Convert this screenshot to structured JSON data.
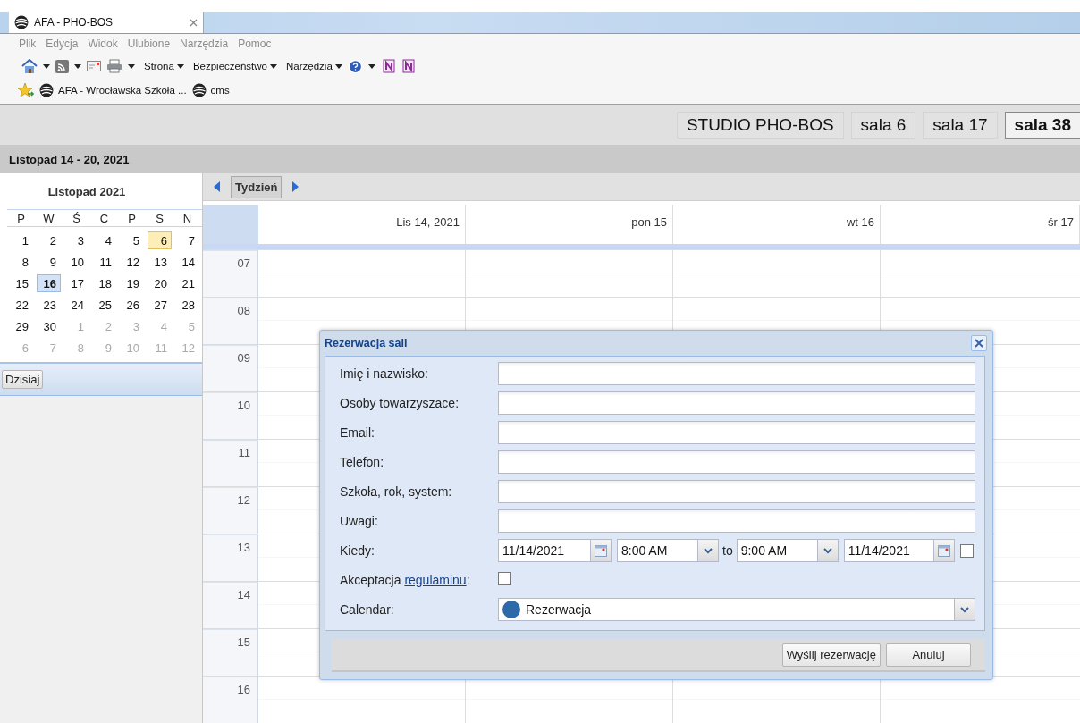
{
  "browser": {
    "tab_title": "AFA - PHO-BOS",
    "menu": [
      "Plik",
      "Edycja",
      "Widok",
      "Ulubione",
      "Narzędzia",
      "Pomoc"
    ],
    "toolbar_menus": [
      "Strona",
      "Bezpieczeństwo",
      "Narzędzia"
    ],
    "favorites": [
      "AFA - Wrocławska Szkoła ...",
      "cms"
    ]
  },
  "rooms": [
    {
      "label": "STUDIO PHO-BOS",
      "selected": false
    },
    {
      "label": "sala 6",
      "selected": false
    },
    {
      "label": "sala 17",
      "selected": false
    },
    {
      "label": "sala 38",
      "selected": true
    }
  ],
  "week_title": "Listopad 14 - 20, 2021",
  "mini_calendar": {
    "title": "Listopad 2021",
    "weekdays": [
      "P",
      "W",
      "Ś",
      "C",
      "P",
      "S",
      "N"
    ],
    "today_button": "Dzisiaj",
    "days": [
      {
        "label": "1",
        "other_month": false,
        "selected": false,
        "today": false
      },
      {
        "label": "2",
        "other_month": false,
        "selected": false,
        "today": false
      },
      {
        "label": "3",
        "other_month": false,
        "selected": false,
        "today": false
      },
      {
        "label": "4",
        "other_month": false,
        "selected": false,
        "today": false
      },
      {
        "label": "5",
        "other_month": false,
        "selected": false,
        "today": false
      },
      {
        "label": "6",
        "other_month": false,
        "selected": false,
        "today": true
      },
      {
        "label": "7",
        "other_month": false,
        "selected": false,
        "today": false
      },
      {
        "label": "8",
        "other_month": false,
        "selected": false,
        "today": false
      },
      {
        "label": "9",
        "other_month": false,
        "selected": false,
        "today": false
      },
      {
        "label": "10",
        "other_month": false,
        "selected": false,
        "today": false
      },
      {
        "label": "11",
        "other_month": false,
        "selected": false,
        "today": false
      },
      {
        "label": "12",
        "other_month": false,
        "selected": false,
        "today": false
      },
      {
        "label": "13",
        "other_month": false,
        "selected": false,
        "today": false
      },
      {
        "label": "14",
        "other_month": false,
        "selected": false,
        "today": false
      },
      {
        "label": "15",
        "other_month": false,
        "selected": false,
        "today": false
      },
      {
        "label": "16",
        "other_month": false,
        "selected": true,
        "today": false
      },
      {
        "label": "17",
        "other_month": false,
        "selected": false,
        "today": false
      },
      {
        "label": "18",
        "other_month": false,
        "selected": false,
        "today": false
      },
      {
        "label": "19",
        "other_month": false,
        "selected": false,
        "today": false
      },
      {
        "label": "20",
        "other_month": false,
        "selected": false,
        "today": false
      },
      {
        "label": "21",
        "other_month": false,
        "selected": false,
        "today": false
      },
      {
        "label": "22",
        "other_month": false,
        "selected": false,
        "today": false
      },
      {
        "label": "23",
        "other_month": false,
        "selected": false,
        "today": false
      },
      {
        "label": "24",
        "other_month": false,
        "selected": false,
        "today": false
      },
      {
        "label": "25",
        "other_month": false,
        "selected": false,
        "today": false
      },
      {
        "label": "26",
        "other_month": false,
        "selected": false,
        "today": false
      },
      {
        "label": "27",
        "other_month": false,
        "selected": false,
        "today": false
      },
      {
        "label": "28",
        "other_month": false,
        "selected": false,
        "today": false
      },
      {
        "label": "29",
        "other_month": false,
        "selected": false,
        "today": false
      },
      {
        "label": "30",
        "other_month": false,
        "selected": false,
        "today": false
      },
      {
        "label": "1",
        "other_month": true,
        "selected": false,
        "today": false
      },
      {
        "label": "2",
        "other_month": true,
        "selected": false,
        "today": false
      },
      {
        "label": "3",
        "other_month": true,
        "selected": false,
        "today": false
      },
      {
        "label": "4",
        "other_month": true,
        "selected": false,
        "today": false
      },
      {
        "label": "5",
        "other_month": true,
        "selected": false,
        "today": false
      },
      {
        "label": "6",
        "other_month": true,
        "selected": false,
        "today": false
      },
      {
        "label": "7",
        "other_month": true,
        "selected": false,
        "today": false
      },
      {
        "label": "8",
        "other_month": true,
        "selected": false,
        "today": false
      },
      {
        "label": "9",
        "other_month": true,
        "selected": false,
        "today": false
      },
      {
        "label": "10",
        "other_month": true,
        "selected": false,
        "today": false
      },
      {
        "label": "11",
        "other_month": true,
        "selected": false,
        "today": false
      },
      {
        "label": "12",
        "other_month": true,
        "selected": false,
        "today": false
      }
    ]
  },
  "calendar": {
    "view_button": "Tydzień",
    "days": [
      "Lis 14, 2021",
      "pon 15",
      "wt 16",
      "śr 17"
    ],
    "hours": [
      "07",
      "08",
      "09",
      "10",
      "11",
      "12",
      "13",
      "14",
      "15",
      "16"
    ]
  },
  "dialog": {
    "title": "Rezerwacja sali",
    "rows": [
      {
        "kind": "text",
        "label": "Imię i nazwisko:"
      },
      {
        "kind": "text",
        "label": "Osoby towarzyszace:"
      },
      {
        "kind": "text",
        "label": "Email:"
      },
      {
        "kind": "text",
        "label": "Telefon:"
      },
      {
        "kind": "text",
        "label": "Szkoła, rok, system:"
      },
      {
        "kind": "text",
        "label": "Uwagi:"
      },
      {
        "kind": "when",
        "label": "Kiedy:",
        "start_date": "11/14/2021",
        "start_time": "8:00 AM",
        "separator": "to",
        "end_time": "9:00 AM",
        "end_date": "11/14/2021",
        "all_day": false
      },
      {
        "kind": "checkbox",
        "label": "Akceptacja ",
        "link": "regulaminu",
        "suffix": ":",
        "checked": false
      },
      {
        "kind": "select",
        "label": "Calendar:",
        "value": "Rezerwacja",
        "color": "#2e6aa8"
      }
    ],
    "buttons": [
      "Wyślij rezerwację",
      "Anuluj"
    ]
  }
}
